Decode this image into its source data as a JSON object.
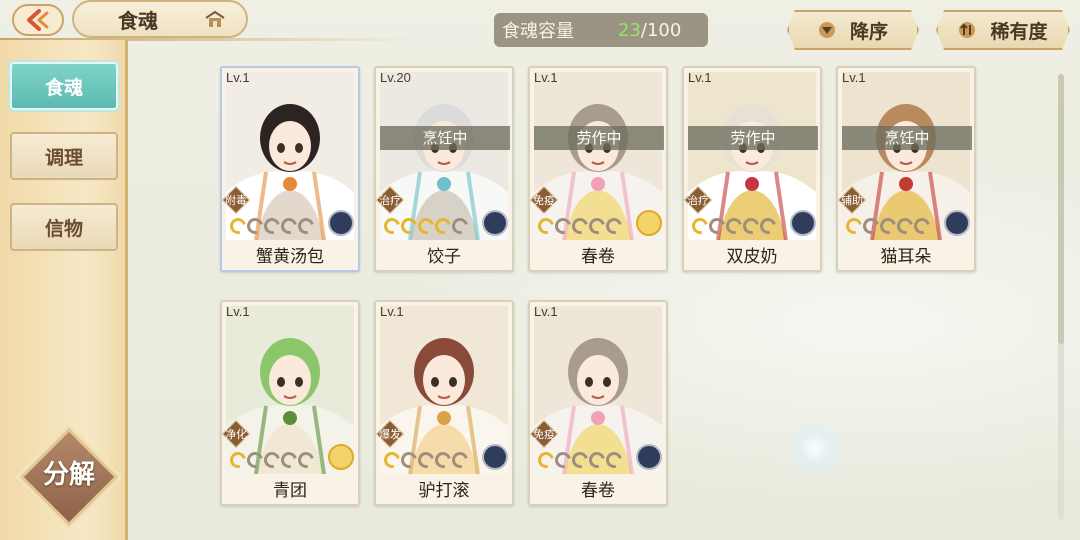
{
  "header": {
    "title": "食魂",
    "capacity_label": "食魂容量",
    "capacity_current": "23",
    "capacity_max": "/100",
    "sort_order_label": "降序",
    "sort_rarity_label": "稀有度"
  },
  "sidebar": {
    "items": [
      {
        "label": "食魂",
        "active": true
      },
      {
        "label": "调理",
        "active": false
      },
      {
        "label": "信物",
        "active": false
      }
    ],
    "decompose_label": "分解"
  },
  "cards": [
    {
      "level": "Lv.1",
      "name": "蟹黄汤包",
      "status": "",
      "role": "附毒",
      "stars_on": 1,
      "emblem": "dark",
      "selected": true,
      "palette": [
        "#f1ece4",
        "#ffffff",
        "#e58a3a",
        "#2b2422",
        "#d7c7b7"
      ]
    },
    {
      "level": "Lv.20",
      "name": "饺子",
      "status": "烹饪中",
      "role": "治疗",
      "stars_on": 4,
      "emblem": "dark",
      "selected": false,
      "palette": [
        "#ece9e2",
        "#f8f8f6",
        "#6fc0cc",
        "#dcdcdc",
        "#c9c0b4"
      ]
    },
    {
      "level": "Lv.1",
      "name": "春卷",
      "status": "劳作中",
      "role": "免疫",
      "stars_on": 1,
      "emblem": "gold",
      "selected": false,
      "palette": [
        "#eee6d8",
        "#f6f3ee",
        "#f1a2b9",
        "#a89b90",
        "#f2d56a"
      ]
    },
    {
      "level": "Lv.1",
      "name": "双皮奶",
      "status": "劳作中",
      "role": "治疗",
      "stars_on": 1,
      "emblem": "dark",
      "selected": false,
      "palette": [
        "#eee5cf",
        "#ffffff",
        "#c4393f",
        "#e7e0d4",
        "#e6b63c"
      ]
    },
    {
      "level": "Lv.1",
      "name": "猫耳朵",
      "status": "烹饪中",
      "role": "辅助",
      "stars_on": 1,
      "emblem": "dark",
      "selected": false,
      "palette": [
        "#eee3cf",
        "#f6f1e8",
        "#c23a33",
        "#b88a5e",
        "#e7b842"
      ]
    },
    {
      "level": "Lv.1",
      "name": "青团",
      "status": "",
      "role": "净化",
      "stars_on": 1,
      "emblem": "gold",
      "selected": false,
      "palette": [
        "#e8eada",
        "#f3f3ea",
        "#5a8f3a",
        "#8cc66a",
        "#f0e3c9"
      ]
    },
    {
      "level": "Lv.1",
      "name": "驴打滚",
      "status": "",
      "role": "爆发",
      "stars_on": 1,
      "emblem": "dark",
      "selected": false,
      "palette": [
        "#f0e7d6",
        "#fbf6ed",
        "#d9a446",
        "#8a4a3a",
        "#f3d08f"
      ]
    },
    {
      "level": "Lv.1",
      "name": "春卷",
      "status": "",
      "role": "免疫",
      "stars_on": 1,
      "emblem": "dark",
      "selected": false,
      "palette": [
        "#eee6d8",
        "#f6f3ee",
        "#f1a2b9",
        "#a89b90",
        "#f2d56a"
      ]
    }
  ]
}
